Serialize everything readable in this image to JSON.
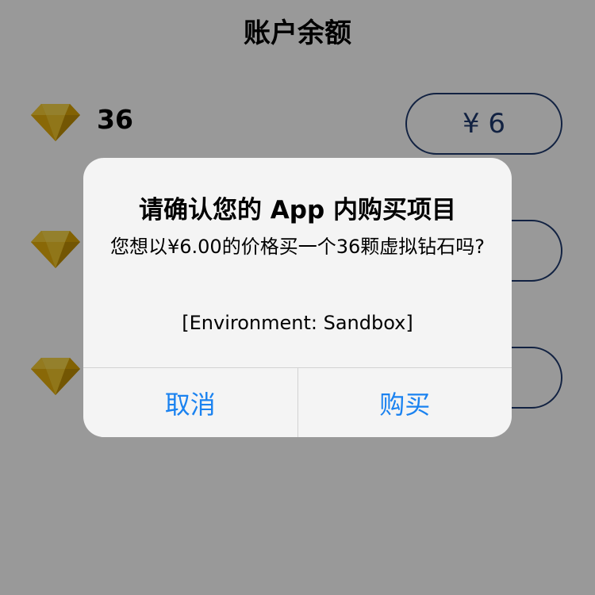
{
  "header": {
    "title": "账户余额"
  },
  "products": [
    {
      "amount": "36",
      "price": "¥ 6",
      "icon": "diamond-icon"
    },
    {
      "amount": "",
      "price": "",
      "icon": "diamond-icon"
    },
    {
      "amount": "",
      "price": "",
      "icon": "diamond-icon"
    }
  ],
  "alert": {
    "title": "请确认您的 App 内购买项目",
    "message": "您想以¥6.00的价格买一个36颗虚拟钻石吗?",
    "environment": "[Environment: Sandbox]",
    "cancel_label": "取消",
    "buy_label": "购买"
  },
  "colors": {
    "accent": "#1a82f0",
    "price_border": "#1f3a6e",
    "gem": "#e8b80f",
    "overlay": "rgba(0,0,0,0.40)"
  }
}
